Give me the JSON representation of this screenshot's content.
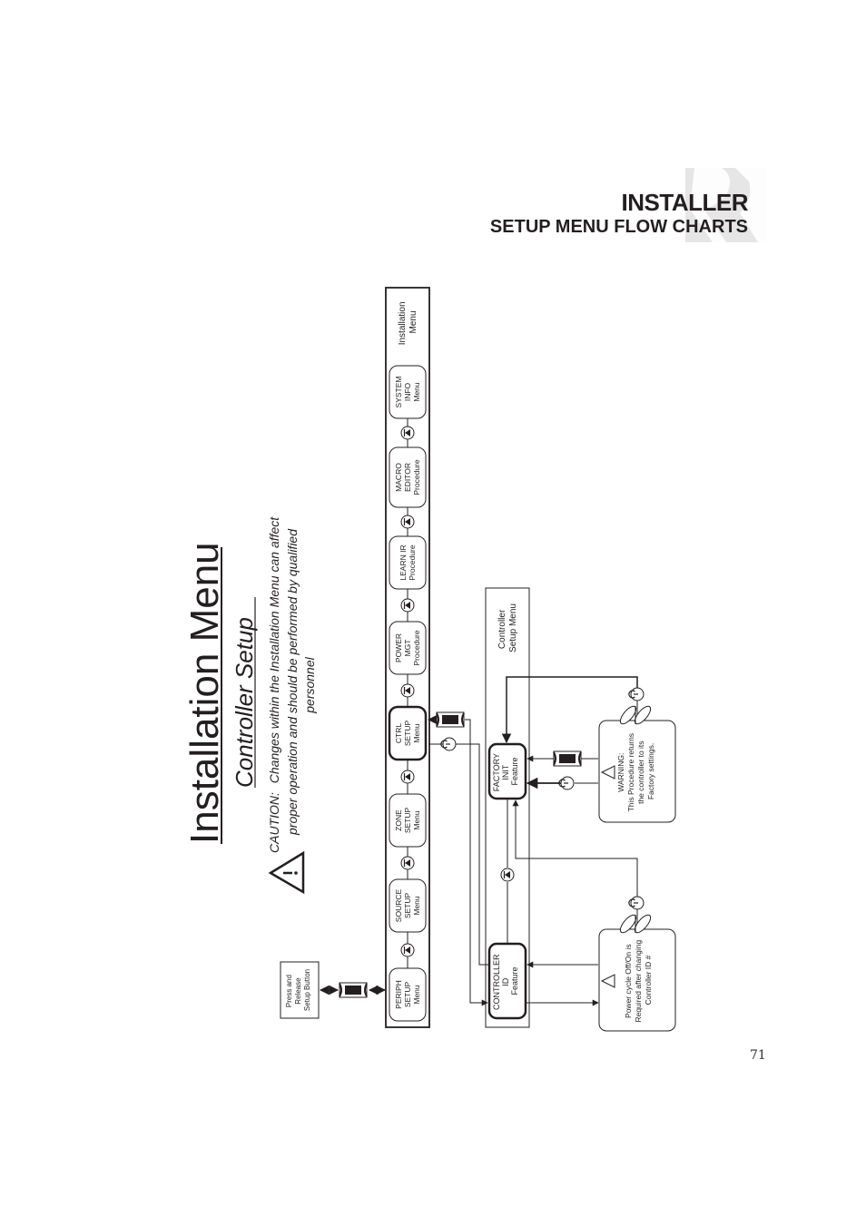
{
  "header": {
    "title": "INSTALLER",
    "subtitle": "SETUP MENU FLOW CHARTS"
  },
  "page_number": "71",
  "flowchart": {
    "title": "Installation Menu",
    "subtitle": "Controller Setup",
    "caution_label": "CAUTION:",
    "caution_lines": [
      "Changes within the Installation Menu can affect",
      "proper operation and should be performed by qualified",
      "personnel"
    ],
    "start_box": [
      "Press and",
      "Release",
      "Setup Button"
    ],
    "installation_menu_label": [
      "Installation",
      "Menu"
    ],
    "menu_items": [
      {
        "lines": [
          "PERIPH",
          "SETUP",
          "Menu"
        ],
        "bold": false
      },
      {
        "lines": [
          "SOURCE",
          "SETUP",
          "Menu"
        ],
        "bold": false
      },
      {
        "lines": [
          "ZONE",
          "SETUP",
          "Menu"
        ],
        "bold": false
      },
      {
        "lines": [
          "CTRL",
          "SETUP",
          "Menu"
        ],
        "bold": true
      },
      {
        "lines": [
          "POWER",
          "MGT",
          "Procedure"
        ],
        "bold": false
      },
      {
        "lines": [
          "LEARN IR",
          "Procedure"
        ],
        "bold": false
      },
      {
        "lines": [
          "MACRO",
          "EDITOR",
          "Procedure"
        ],
        "bold": false
      },
      {
        "lines": [
          "SYSTEM",
          "INFO",
          "Menu"
        ],
        "bold": false
      }
    ],
    "controller_setup_label": [
      "Controller",
      "Setup Menu"
    ],
    "controller_id": [
      "CONTROLLER",
      "ID",
      "Feature"
    ],
    "factory_init": [
      "FACTORY",
      "INIT",
      "Feature"
    ],
    "warning_box": [
      "WARNING:",
      "This Procedure returns",
      "the controller to its",
      "Factory settings."
    ],
    "power_cycle_box": [
      "Power cycle Off/On is",
      "Required after changing",
      "Controller ID #"
    ]
  },
  "icons": {
    "watermark": "brand-logo-watermark",
    "caution": "warning-triangle-icon",
    "next": "next-arrow-button-icon",
    "enter": "enter-button-icon",
    "power": "power-button-icon",
    "volume": "volume-rocker-icon"
  }
}
